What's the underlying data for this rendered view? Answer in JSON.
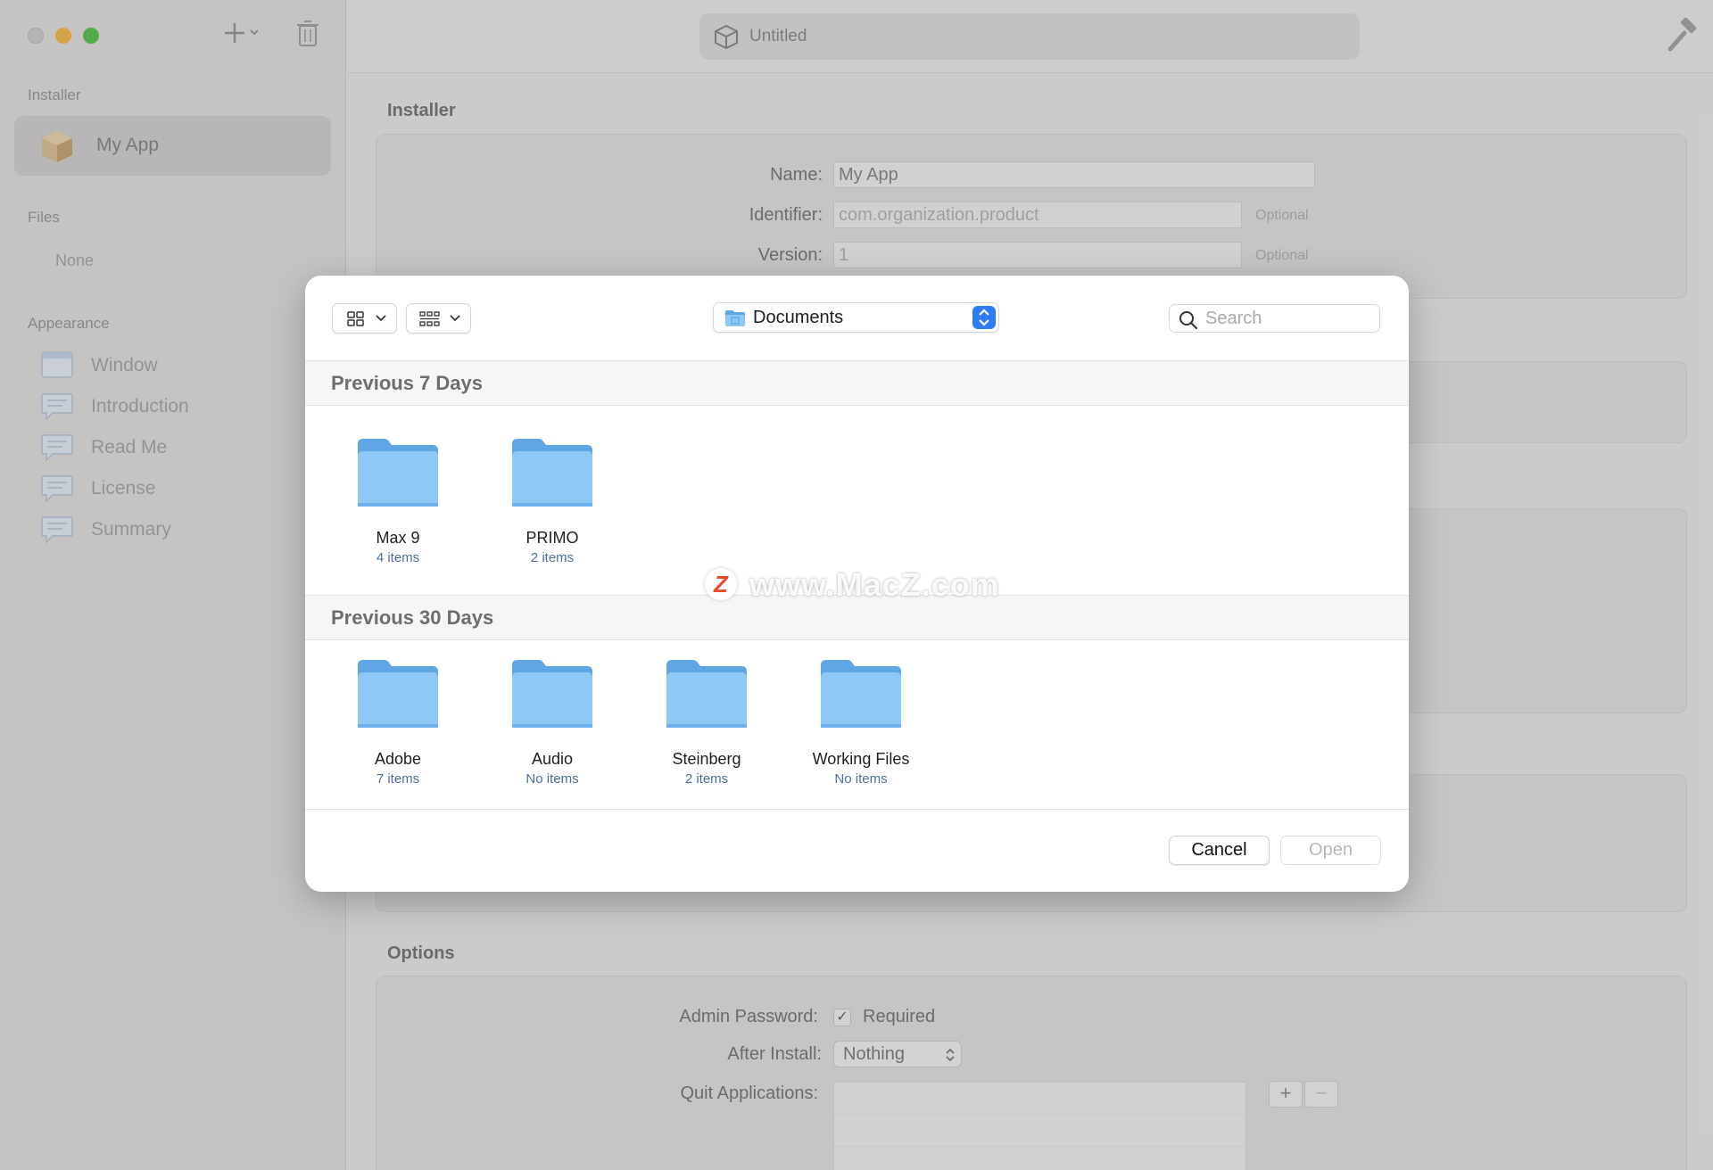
{
  "window": {
    "title": "Untitled"
  },
  "sidebar": {
    "installer_heading": "Installer",
    "selected_item": "My App",
    "files_heading": "Files",
    "files_empty": "None",
    "appearance_heading": "Appearance",
    "appearance_items": [
      {
        "label": "Window",
        "icon": "window-icon"
      },
      {
        "label": "Introduction",
        "icon": "speech-bubble-icon"
      },
      {
        "label": "Read Me",
        "icon": "speech-bubble-icon"
      },
      {
        "label": "License",
        "icon": "speech-bubble-icon"
      },
      {
        "label": "Summary",
        "icon": "speech-bubble-icon"
      }
    ]
  },
  "installer_panel": {
    "title": "Installer",
    "name_label": "Name:",
    "name_value": "My App",
    "identifier_label": "Identifier:",
    "identifier_placeholder": "com.organization.product",
    "identifier_hint": "Optional",
    "version_label": "Version:",
    "version_placeholder": "1",
    "version_hint": "Optional"
  },
  "options_panel": {
    "title": "Options",
    "admin_password_label": "Admin Password:",
    "admin_password_value": "Required",
    "admin_password_checked": true,
    "after_install_label": "After Install:",
    "after_install_value": "Nothing",
    "quit_apps_label": "Quit Applications:",
    "add_symbol": "+",
    "remove_symbol": "−"
  },
  "dialog": {
    "location": "Documents",
    "search_placeholder": "Search",
    "groups": [
      {
        "title": "Previous 7 Days",
        "items": [
          {
            "name": "Max 9",
            "count": "4 items"
          },
          {
            "name": "PRIMO",
            "count": "2 items"
          }
        ]
      },
      {
        "title": "Previous 30 Days",
        "items": [
          {
            "name": "Adobe",
            "count": "7 items"
          },
          {
            "name": "Audio",
            "count": "No items"
          },
          {
            "name": "Steinberg",
            "count": "2 items"
          },
          {
            "name": "Working Files",
            "count": "No items"
          }
        ]
      }
    ],
    "cancel_label": "Cancel",
    "open_label": "Open"
  },
  "watermark": {
    "logo_letter": "Z",
    "text": "www.MacZ.com"
  },
  "colors": {
    "accent": "#2e7cf6",
    "folder": "#8ec9f5",
    "folder_tab": "#5fa6e4"
  }
}
